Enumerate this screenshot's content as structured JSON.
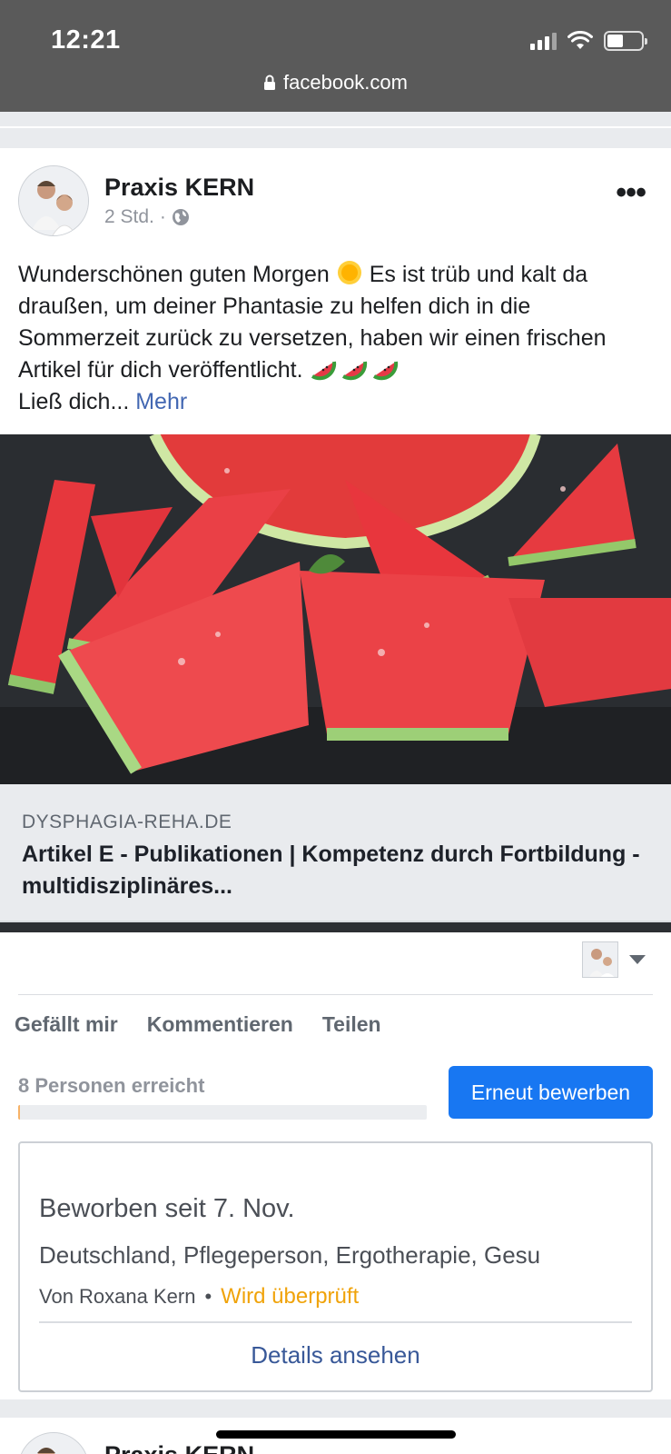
{
  "status_bar": {
    "time": "12:21",
    "url": "facebook.com",
    "icons": [
      "signal-icon",
      "wifi-icon",
      "battery-icon"
    ],
    "battery_level": 0.46
  },
  "post": {
    "page_name": "Praxis KERN",
    "time_ago": "2 Std.",
    "separator": "·",
    "privacy_icon": "globe-icon",
    "text_before_sun": "Wunderschönen guten Morgen ",
    "text_after_sun": " Es ist trüb und kalt da draußen, um deiner Phantasie zu helfen dich in die Sommerzeit zurück zu versetzen, haben wir einen frischen Artikel für dich veröffentlicht. ",
    "text_line_last": "Ließ dich...",
    "more_label": "Mehr",
    "image_description_icon": "watermelon-image",
    "link": {
      "domain": "DYSPHAGIA-REHA.DE",
      "title": "Artikel E - Publikationen | Kompetenz durch Fortbildung - multidisziplinäres..."
    },
    "actions": {
      "like": "Gefällt mir",
      "comment": "Kommentieren",
      "share": "Teilen"
    },
    "reach": {
      "label": "8 Personen erreicht",
      "progress": 0.004
    },
    "boost_button": "Erneut bewerben",
    "ad": {
      "title": "Beworben seit 7. Nov.",
      "targets": "Deutschland, Pflegeperson, Ergotherapie, Gesu",
      "by": "Von Roxana Kern",
      "bullet": "•",
      "status": "Wird überprüft",
      "details_link": "Details ansehen"
    }
  },
  "next_post": {
    "page_name": "Praxis KERN"
  },
  "colors": {
    "accent": "#1877f2",
    "link": "#4267b2",
    "pending": "#f0a30a",
    "feed_bg": "#e9ebee"
  }
}
